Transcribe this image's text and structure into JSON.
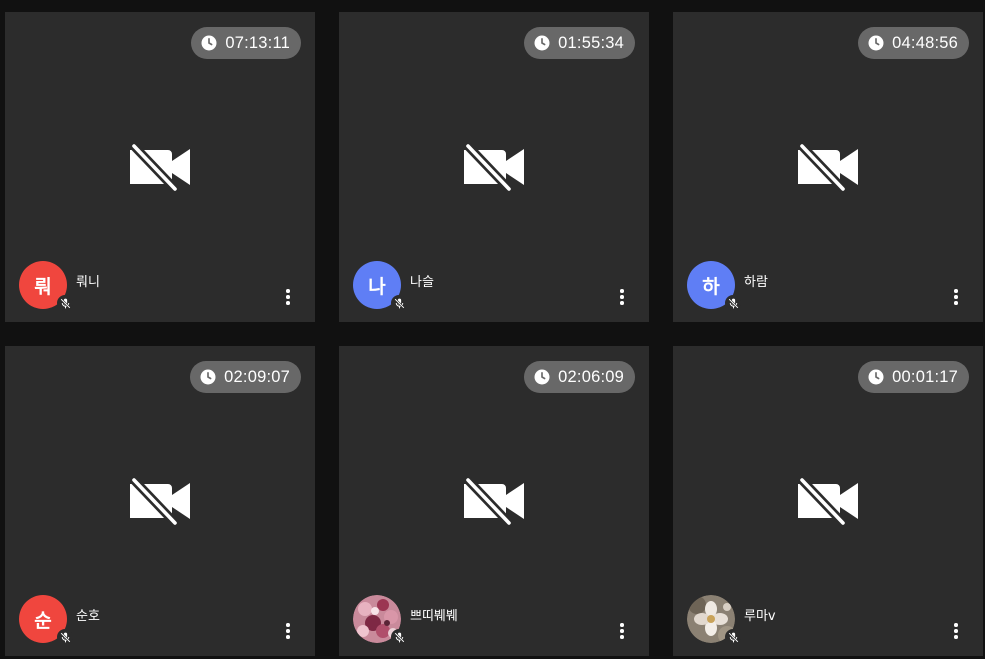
{
  "participants": [
    {
      "name": "뤄니",
      "initial": "뤄",
      "avatar_color": "#f0463e",
      "timer": "07:13:11",
      "avatar_type": "initial"
    },
    {
      "name": "나슬",
      "initial": "나",
      "avatar_color": "#5f7ef5",
      "timer": "01:55:34",
      "avatar_type": "initial"
    },
    {
      "name": "하람",
      "initial": "하",
      "avatar_color": "#5f7ef5",
      "timer": "04:48:56",
      "avatar_type": "initial"
    },
    {
      "name": "순호",
      "initial": "순",
      "avatar_color": "#f0463e",
      "timer": "02:09:07",
      "avatar_type": "initial"
    },
    {
      "name": "쁘띠붸붸",
      "initial": "",
      "avatar_color": "#b06a7e",
      "timer": "02:06:09",
      "avatar_type": "photo"
    },
    {
      "name": "루마v",
      "initial": "",
      "avatar_color": "#8b8173",
      "timer": "00:01:17",
      "avatar_type": "photo"
    }
  ],
  "icons": {
    "timer": "clock-icon",
    "video": "video-off-icon",
    "mic": "mic-off-icon",
    "menu": "more-vert-icon"
  },
  "colors": {
    "background": "#111111",
    "tile": "#2c2c2c",
    "timer_pill": "#686868"
  }
}
